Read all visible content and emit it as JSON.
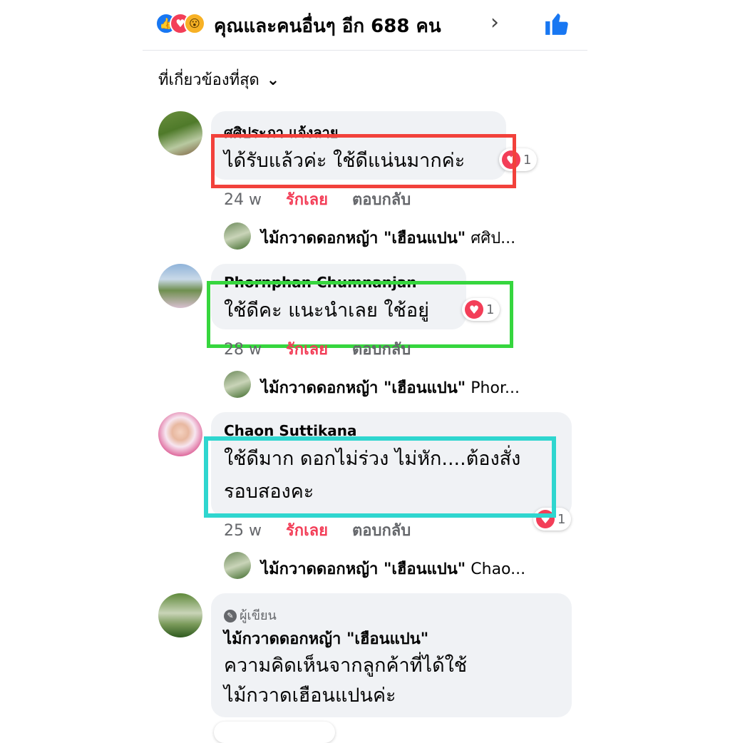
{
  "header": {
    "reaction_summary": "คุณและคนอื่นๆ อีก 688 คน",
    "reaction_icons": [
      "like-icon",
      "love-icon",
      "wow-icon"
    ]
  },
  "sort": {
    "label": "ที่เกี่ยวข้องที่สุด"
  },
  "comments": [
    {
      "name": "ศศิประภา แจ้งลาย",
      "text": [
        "ได้รับแล้วค่ะ ใช้ดีแน่นมากค่ะ"
      ],
      "time": "24 w",
      "love_label": "รักเลย",
      "reply_label": "ตอบกลับ",
      "heart_count": "1",
      "reply_preview": {
        "name": "ไม้กวาดดอกหญ้า \"เฮือนแปน\"",
        "snippet": " ศศิป..."
      }
    },
    {
      "name": "Phornphan Chumnanjan",
      "text": [
        "ใช้ดีคะ แนะนำเลย ใช้อยู่"
      ],
      "time": "28 w",
      "love_label": "รักเลย",
      "reply_label": "ตอบกลับ",
      "heart_count": "1",
      "reply_preview": {
        "name": "ไม้กวาดดอกหญ้า \"เฮือนแปน\"",
        "snippet": " Phor..."
      }
    },
    {
      "name": "Chaon Suttikana",
      "text": [
        "ใช้ดีมาก ดอกไม่ร่วง ไม่หัก....ต้องสั่ง",
        "รอบสองคะ"
      ],
      "time": "25 w",
      "love_label": "รักเลย",
      "reply_label": "ตอบกลับ",
      "heart_count": "1",
      "reply_preview": {
        "name": "ไม้กวาดดอกหญ้า \"เฮือนแปน\"",
        "snippet": " Chao..."
      }
    },
    {
      "author_tag": "ผู้เขียน",
      "name": "ไม้กวาดดอกหญ้า \"เฮือนแปน\"",
      "text": [
        "ความคิดเห็นจากลูกค้าที่ได้ใช้",
        "ไม้กวาดเฮือนแปนค่ะ"
      ]
    }
  ],
  "colors": {
    "highlight_red": "#f2413b",
    "highlight_green": "#36d63e",
    "highlight_cyan": "#2fd6cf",
    "love": "#f33e58",
    "like": "#1877f2"
  }
}
